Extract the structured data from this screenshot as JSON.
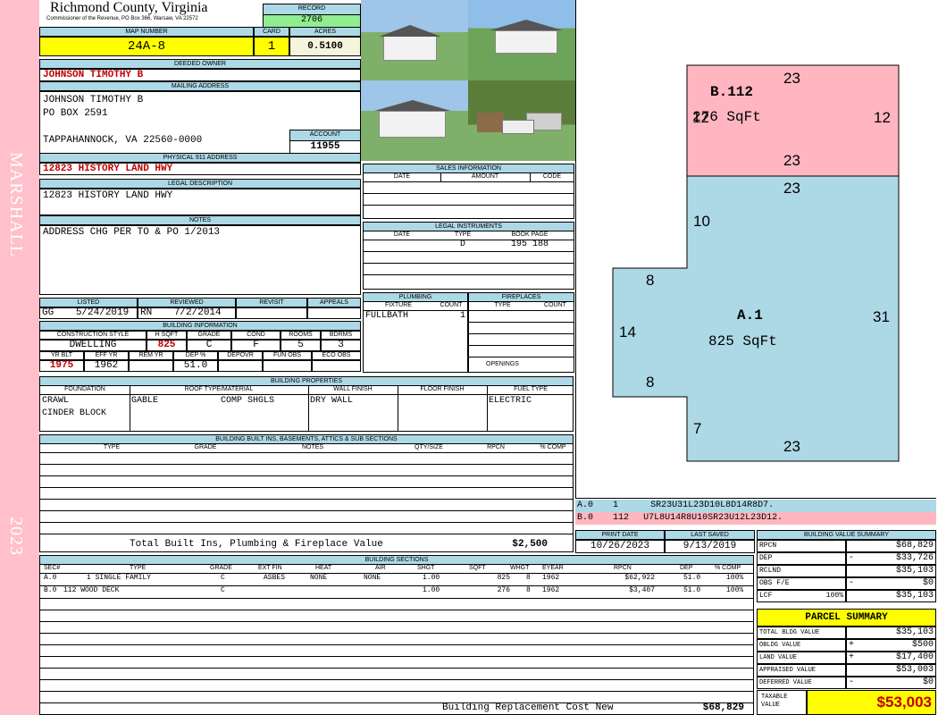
{
  "header": {
    "county": "Richmond County, Virginia",
    "commissioner": "Commissioner of the Revenue, PO Box 366, Warsaw, VA 22572",
    "record_label": "RECORD",
    "record": "2706",
    "map_number_label": "MAP NUMBER",
    "map_number": "24A-8",
    "card_label": "CARD",
    "card": "1",
    "acres_label": "ACRES",
    "acres": "0.5100"
  },
  "sidebar": {
    "district": "MARSHALL",
    "year": "2023"
  },
  "owner": {
    "deeded_owner_label": "DEEDED OWNER",
    "deeded_owner": "JOHNSON TIMOTHY B",
    "mailing_label": "MAILING ADDRESS",
    "mailing_lines": [
      "JOHNSON TIMOTHY B",
      "PO BOX 2591",
      "TAPPAHANNOCK, VA 22560-0000"
    ],
    "account_label": "ACCOUNT",
    "account": "11955",
    "physical_label": "PHYSICAL 911 ADDRESS",
    "physical": "12823 HISTORY LAND HWY",
    "legal_label": "LEGAL DESCRIPTION",
    "legal": "12823 HISTORY LAND HWY",
    "notes_label": "NOTES",
    "notes": "ADDRESS CHG PER TO & PO 1/2013"
  },
  "review": {
    "listed_label": "LISTED",
    "reviewed_label": "REVIEWED",
    "revisit_label": "REVISIT",
    "appeals_label": "APPEALS",
    "listed_by": "GG",
    "listed_date": "5/24/2019",
    "reviewed_by": "RN",
    "reviewed_date": "7/2/2014"
  },
  "building_info": {
    "label": "BUILDING INFORMATION",
    "h_construction": "CONSTRUCTION STYLE",
    "h_sqft": "H SQFT",
    "h_grade": "GRADE",
    "h_cond": "COND",
    "h_rooms": "ROOMS",
    "h_bdrms": "BDRMS",
    "construction": "DWELLING",
    "sqft": "825",
    "grade": "C",
    "cond": "F",
    "rooms": "5",
    "bdrms": "3",
    "h_yrblt": "YR BLT",
    "h_effyr": "EFF YR",
    "h_remyr": "REM YR",
    "h_dep": "DEP %",
    "h_depovr": "DEPOVR",
    "h_funobs": "FUN OBS",
    "h_ecoobs": "ECO OBS",
    "yrblt": "1975",
    "effyr": "1962",
    "dep": "51.0"
  },
  "sales": {
    "label": "SALES INFORMATION",
    "h_date": "DATE",
    "h_amount": "AMOUNT",
    "h_code": "CODE"
  },
  "legal_instruments": {
    "label": "LEGAL INSTRUMENTS",
    "h_date": "DATE",
    "h_type": "TYPE",
    "h_book": "BOOK PAGE",
    "type": "D",
    "book": "195 188"
  },
  "plumbing": {
    "label": "PLUMBING",
    "h_fixture": "FIXTURE",
    "h_count": "COUNT",
    "fixture": "FULLBATH",
    "count": "1"
  },
  "fireplaces": {
    "label": "FIREPLACES",
    "h_type": "TYPE",
    "h_count": "COUNT",
    "openings": "OPENINGS"
  },
  "properties": {
    "label": "BUILDING PROPERTIES",
    "h_foundation": "FOUNDATION",
    "h_roof": "ROOF TYPE/MATERIAL",
    "h_wall": "WALL FINISH",
    "h_floor": "FLOOR FINISH",
    "h_fuel": "FUEL TYPE",
    "foundation1": "CRAWL",
    "foundation2": "CINDER BLOCK",
    "roof_type": "GABLE",
    "roof_material": "COMP SHGLS",
    "wall": "DRY WALL",
    "fuel": "ELECTRIC"
  },
  "builtins": {
    "label": "BUILDING BUILT INS, BASEMENTS, ATTICS & SUB SECTIONS",
    "h_type": "TYPE",
    "h_grade": "GRADE",
    "h_notes": "NOTES",
    "h_qty": "QTY/SIZE",
    "h_rpcn": "RPCN",
    "h_comp": "% COMP",
    "total_label": "Total Built Ins, Plumbing & Fireplace Value",
    "total": "$2,500"
  },
  "sections": {
    "label": "BUILDING SECTIONS",
    "headers": [
      "SEC#",
      "TYPE",
      "GRADE",
      "EXT FIN",
      "HEAT",
      "AIR",
      "SHGT",
      "SQFT",
      "WHGT",
      "EYEAR",
      "RPCN",
      "DEP",
      "% COMP"
    ],
    "rows": [
      [
        "A.0",
        "1 SINGLE FAMILY",
        "C",
        "ASBES",
        "NONE",
        "NONE",
        "1.00",
        "825",
        "8",
        "1962",
        "$62,922",
        "51.0",
        "100%"
      ],
      [
        "B.0",
        "112 WOOD DECK",
        "C",
        "",
        "",
        "",
        "1.00",
        "276",
        "8",
        "1962",
        "$3,407",
        "51.0",
        "100%"
      ]
    ],
    "replacement_label": "Building Replacement Cost New",
    "replacement": "$68,829"
  },
  "sketch": {
    "b_label": "B.112",
    "b_area": "276 SqFt",
    "b_dims": {
      "top": "23",
      "left": "12",
      "right": "12",
      "bottom": "23"
    },
    "a_label": "A.1",
    "a_area": "825 SqFt",
    "a_dims": {
      "top": "23",
      "left_upper": "10",
      "step_top": "8",
      "left_mid": "14",
      "step_bottom": "8",
      "left_lower": "7",
      "right": "31",
      "bottom": "23"
    },
    "codes": [
      {
        "id": "A.0",
        "num": "1",
        "code": "SR23U31L23D10L8D14R8D7."
      },
      {
        "id": "B.0",
        "num": "112",
        "code": "U7L8U14R8U10SR23U12L23D12."
      }
    ]
  },
  "dates": {
    "print_label": "PRINT DATE",
    "print": "10/26/2023",
    "saved_label": "LAST SAVED",
    "saved": "9/13/2019"
  },
  "value_summary": {
    "label": "BUILDING VALUE SUMMARY",
    "rpcn": "$68,829",
    "dep_sign": "-",
    "dep": "$33,726",
    "rclnd": "$35,103",
    "obs_sign": "-",
    "obs": "$0",
    "lcf_pct": "100%",
    "lcf": "$35,103",
    "labels": [
      "RPCN",
      "DEP",
      "RCLND",
      "OBS F/E",
      "LCF"
    ]
  },
  "parcel": {
    "label": "PARCEL SUMMARY",
    "labels": [
      "TOTAL BLDG VALUE",
      "OBLDG VALUE",
      "LAND VALUE",
      "APPRAISED VALUE",
      "DEFERRED VALUE"
    ],
    "total_bldg": "$35,103",
    "obldg_sign": "+",
    "obldg": "$500",
    "land_sign": "+",
    "land": "$17,400",
    "appraised": "$53,003",
    "deferred_sign": "-",
    "deferred": "$0",
    "taxable_label": "TAXABLE VALUE",
    "taxable": "$53,003"
  },
  "colors": {
    "sidebar": "#ffc0cb",
    "header_blue": "#add8e6",
    "yellow": "#ffff00",
    "record_green": "#90ee90",
    "deck_pink": "#ffb6c1",
    "house_blue": "#add8e6"
  }
}
